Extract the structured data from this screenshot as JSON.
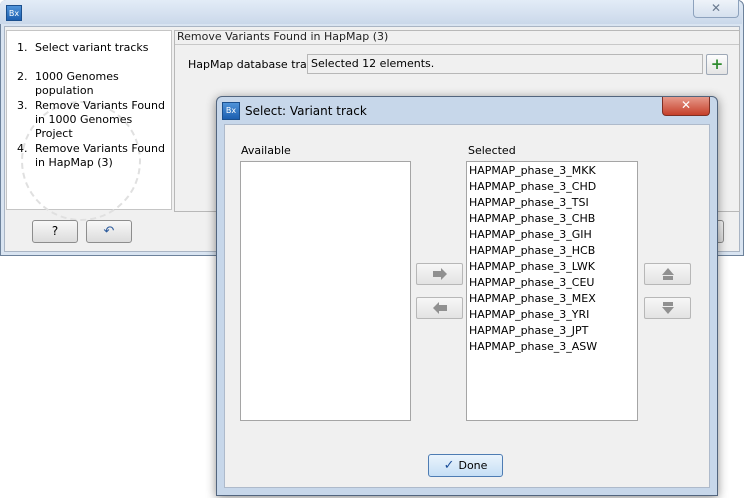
{
  "wizard": {
    "app_icon": "Bx",
    "close_glyph": "✕",
    "steps": [
      {
        "num": "1.",
        "label": "Select variant tracks"
      },
      {
        "num": "2.",
        "label": "1000 Genomes population"
      },
      {
        "num": "3.",
        "label": "Remove Variants Found in 1000 Genomes Project"
      },
      {
        "num": "4.",
        "label": "Remove Variants Found in HapMap (3)"
      }
    ],
    "panel_title": "Remove Variants Found in HapMap (3)",
    "hapmap_label": "HapMap database track",
    "hapmap_value": "Selected 12 elements.",
    "add_glyph": "+",
    "help_label": "?",
    "back_glyph": "↶"
  },
  "dialog": {
    "app_icon": "Bx",
    "title": "Select: Variant track",
    "close_glyph": "✕",
    "available_label": "Available",
    "selected_label": "Selected",
    "available_items": [],
    "selected_items": [
      "HAPMAP_phase_3_MKK",
      "HAPMAP_phase_3_CHD",
      "HAPMAP_phase_3_TSI",
      "HAPMAP_phase_3_CHB",
      "HAPMAP_phase_3_GIH",
      "HAPMAP_phase_3_HCB",
      "HAPMAP_phase_3_LWK",
      "HAPMAP_phase_3_CEU",
      "HAPMAP_phase_3_MEX",
      "HAPMAP_phase_3_YRI",
      "HAPMAP_phase_3_JPT",
      "HAPMAP_phase_3_ASW"
    ],
    "move_right_icon": "arrow-right-icon",
    "move_left_icon": "arrow-left-icon",
    "move_up_icon": "arrow-up-icon",
    "move_down_icon": "arrow-down-icon",
    "done_check": "✓",
    "done_label": "Done"
  }
}
